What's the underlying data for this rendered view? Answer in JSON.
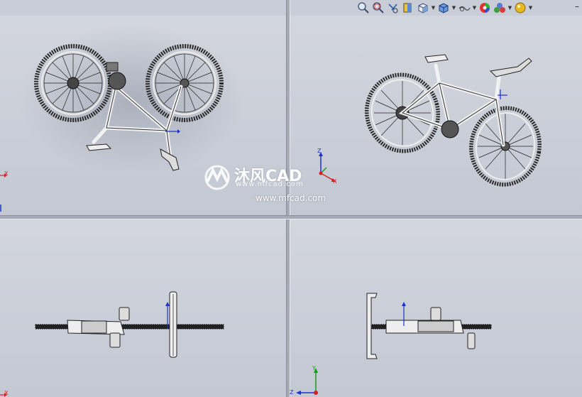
{
  "app": {
    "viewports": [
      "trimetric-view",
      "isometric-view",
      "top-view",
      "side-view"
    ]
  },
  "toolbar": {
    "buttons": [
      {
        "name": "zoom-to-fit-icon"
      },
      {
        "name": "zoom-to-area-icon"
      },
      {
        "name": "previous-view-icon"
      },
      {
        "name": "section-view-icon"
      },
      {
        "name": "view-orientation-icon",
        "dropdown": true
      },
      {
        "name": "display-style-icon",
        "dropdown": true
      },
      {
        "name": "hide-show-items-icon",
        "dropdown": true
      },
      {
        "name": "edit-appearance-icon"
      },
      {
        "name": "apply-scene-icon",
        "dropdown": true
      },
      {
        "name": "view-settings-icon",
        "dropdown": true
      }
    ],
    "minimize_label": "–"
  },
  "triad": {
    "x_label": "X",
    "y_label": "Y",
    "z_label": "Z"
  },
  "watermark": {
    "brand": "沐风CAD",
    "sub": "www.mfcad.com",
    "url": "www.mfcad.com"
  },
  "colors": {
    "background": "#ccd0da",
    "splitter": "#a5aab6",
    "axis_x": "#d62020",
    "axis_y": "#1a9a1a",
    "axis_z": "#2030d0",
    "model": "#1a1a1a"
  }
}
